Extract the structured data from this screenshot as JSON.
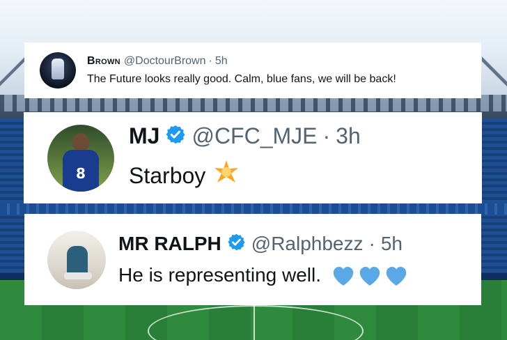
{
  "tweets": [
    {
      "name": "Brown",
      "handle": "@DoctourBrown",
      "separator": "·",
      "time": "5h",
      "text": "The Future looks really good. Calm, blue fans, we will be back!",
      "verified": false
    },
    {
      "name": "MJ",
      "handle": "@CFC_MJE",
      "separator": "·",
      "time": "3h",
      "text": "Starboy",
      "verified": true,
      "emoji": "sparkle-star-icon",
      "avatar_number": "8"
    },
    {
      "name": "MR RALPH",
      "handle": "@Ralphbezz",
      "separator": "·",
      "time": "5h",
      "text": "He is representing well.",
      "verified": true,
      "emoji": "blue-heart-icon",
      "emoji_count": 3
    }
  ],
  "colors": {
    "verified_badge": "#1d9bf0",
    "handle_gray": "#536471",
    "text_black": "#0f1419",
    "heart_blue": "#5aa9e6",
    "star_orange": "#f7a823"
  }
}
